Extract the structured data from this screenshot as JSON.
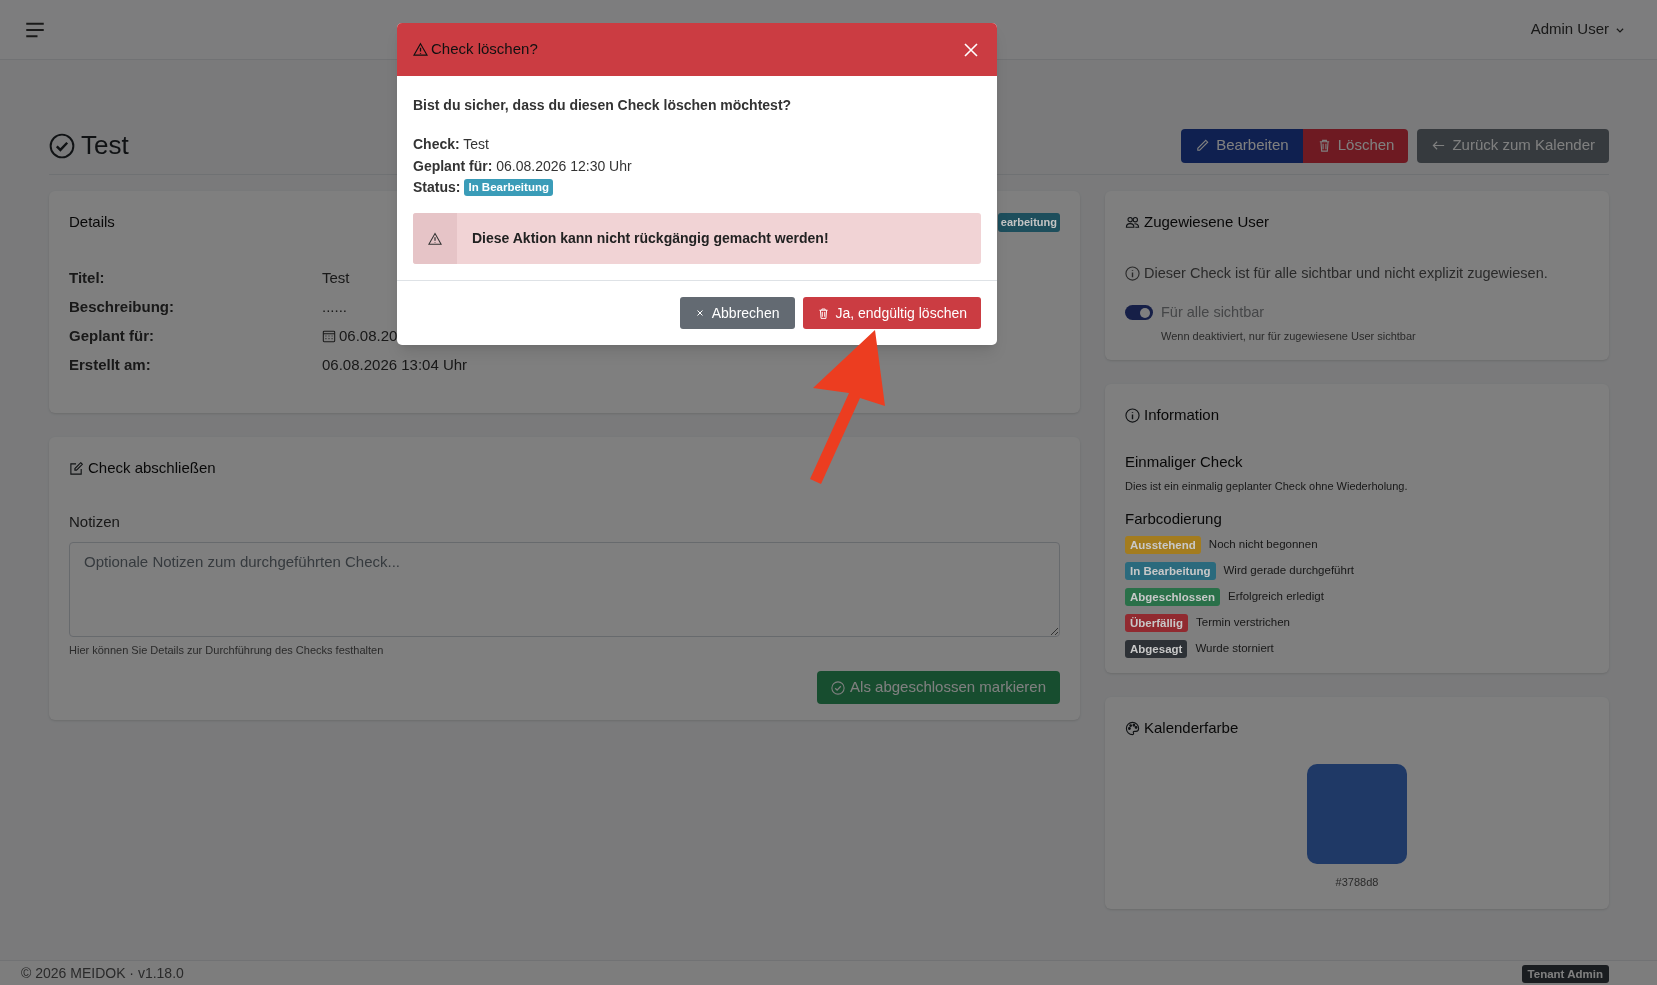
{
  "navbar": {
    "user_menu": "Admin User"
  },
  "page": {
    "title": "Test",
    "actions": [
      {
        "label": "Bearbeiten",
        "kind": "edit"
      },
      {
        "label": "Löschen",
        "kind": "delete"
      },
      {
        "label": "Zurück zum Kalender",
        "kind": "back"
      }
    ]
  },
  "details": {
    "title": "Details",
    "status_badge": "earbeitung",
    "fields": [
      {
        "label": "Titel:",
        "value": "Test",
        "kind": "text"
      },
      {
        "label": "Beschreibung:",
        "value": "......",
        "kind": "text"
      },
      {
        "label": "Geplant für:",
        "value": "06.08.20",
        "kind": "date"
      },
      {
        "label": "Erstellt am:",
        "value": "06.08.2026 13:04 Uhr",
        "kind": "text"
      }
    ]
  },
  "complete_check": {
    "title": "Check abschließen",
    "notes_label": "Notizen",
    "notes_placeholder": "Optionale Notizen zum durchgeführten Check...",
    "help": "Hier können Sie Details zur Durchführung des Checks festhalten",
    "submit": "Als abgeschlossen markieren"
  },
  "assigned_users": {
    "title": "Zugewiesene User",
    "info": "Dieser Check ist für alle sichtbar und nicht explizit zugewiesen.",
    "toggle": {
      "label": "Für alle sichtbar",
      "on": true,
      "hint": "Wenn deaktiviert, nur für zugewiesene User sichtbar"
    }
  },
  "information": {
    "title": "Information",
    "type_title": "Einmaliger Check",
    "type_text": "Dies ist ein einmalig geplanter Check ohne Wiederholung.",
    "legend_title": "Farbcodierung",
    "legend": [
      {
        "badge": "Ausstehend",
        "color": "#a37c1f",
        "text": "Noch nicht begonnen"
      },
      {
        "badge": "In Bearbeitung",
        "color": "#2b6a7d",
        "text": "Wird gerade durchgeführt"
      },
      {
        "badge": "Abgeschlossen",
        "color": "#2a7049",
        "text": "Erfolgreich erledigt"
      },
      {
        "badge": "Überfällig",
        "color": "#912a30",
        "text": "Termin verstrichen"
      },
      {
        "badge": "Abgesagt",
        "color": "#2d3136",
        "text": "Wurde storniert"
      }
    ]
  },
  "calendar_color": {
    "title": "Kalenderfarbe",
    "color": "#1f3966",
    "code": "#3788d8"
  },
  "footer": {
    "copyright": "© 2026 MEIDOK · v1.18.0",
    "role_badge": "Tenant Admin"
  },
  "modal": {
    "title": "Check löschen?",
    "question": "Bist du sicher, dass du diesen Check löschen möchtest?",
    "facts": [
      {
        "kind": "text",
        "text": "**Check:** Test"
      },
      {
        "kind": "text",
        "text": "**Geplant für:** 06.08.2026 12:30 Uhr"
      },
      {
        "kind": "badge",
        "label": "Status:",
        "badge": "In Bearbeitung"
      }
    ],
    "warning": "Diese Aktion kann nicht rückgängig gemacht werden!",
    "buttons": [
      {
        "label": "Abbrechen",
        "kind": "cancel"
      },
      {
        "label": "Ja, endgültig löschen",
        "kind": "confirm"
      }
    ]
  }
}
